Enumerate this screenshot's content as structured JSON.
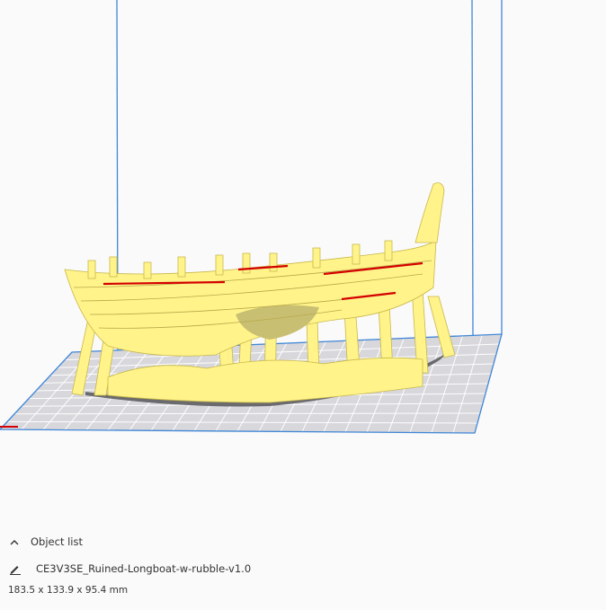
{
  "object_panel": {
    "header_label": "Object list",
    "object_name": "CE3V3SE_Ruined-Longboat-w-rubble-v1.0",
    "dimensions": "183.5 x 133.9 x 95.4 mm"
  },
  "viewport": {
    "model_color": "#fff38a",
    "overhang_color": "#d40000",
    "build_volume_line_color": "#3f86d6",
    "plate_color": "#d7d7dc",
    "grid_line_color": "#ffffff",
    "shadow_color": "#6b6b6e"
  }
}
